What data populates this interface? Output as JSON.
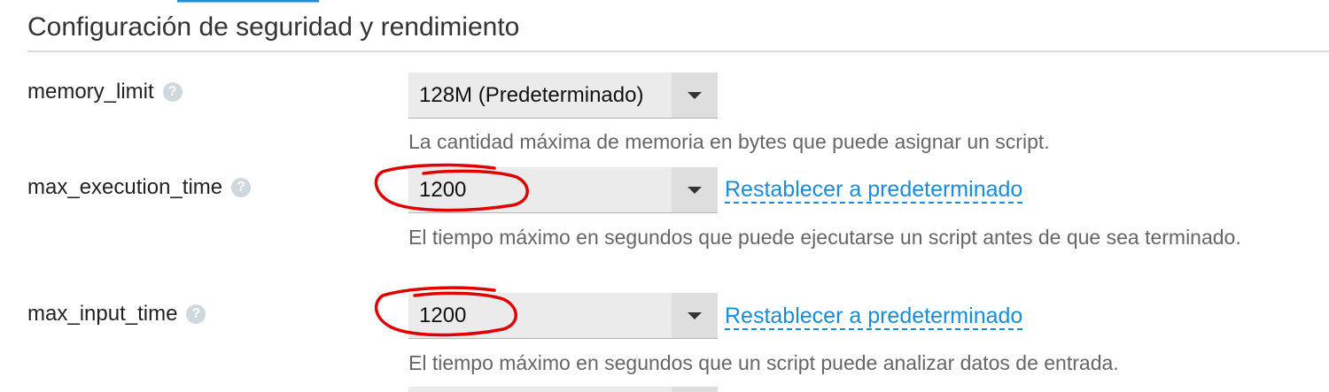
{
  "header": {
    "section_title": "Configuración de seguridad y rendimiento"
  },
  "settings": [
    {
      "name": "memory_limit",
      "help_icon": "question-mark-icon",
      "value": "128M (Predeterminado)",
      "help_text": "La cantidad máxima de memoria en bytes que puede asignar un script.",
      "reset_label": ""
    },
    {
      "name": "max_execution_time",
      "help_icon": "question-mark-icon",
      "value": "1200",
      "help_text": "El tiempo máximo en segundos que puede ejecutarse un script antes de que sea terminado.",
      "reset_label": "Restablecer a predeterminado"
    },
    {
      "name": "max_input_time",
      "help_icon": "question-mark-icon",
      "value": "1200",
      "help_text": "El tiempo máximo en segundos que un script puede analizar datos de entrada.",
      "reset_label": "Restablecer a predeterminado"
    }
  ],
  "icons": {
    "help": "?",
    "dropdown": "chevron-down-icon"
  },
  "colors": {
    "link": "#1a8cd8",
    "annotation": "#e00000",
    "select_bg": "#ebebeb",
    "help_icon_bg": "#cfd8dc"
  }
}
